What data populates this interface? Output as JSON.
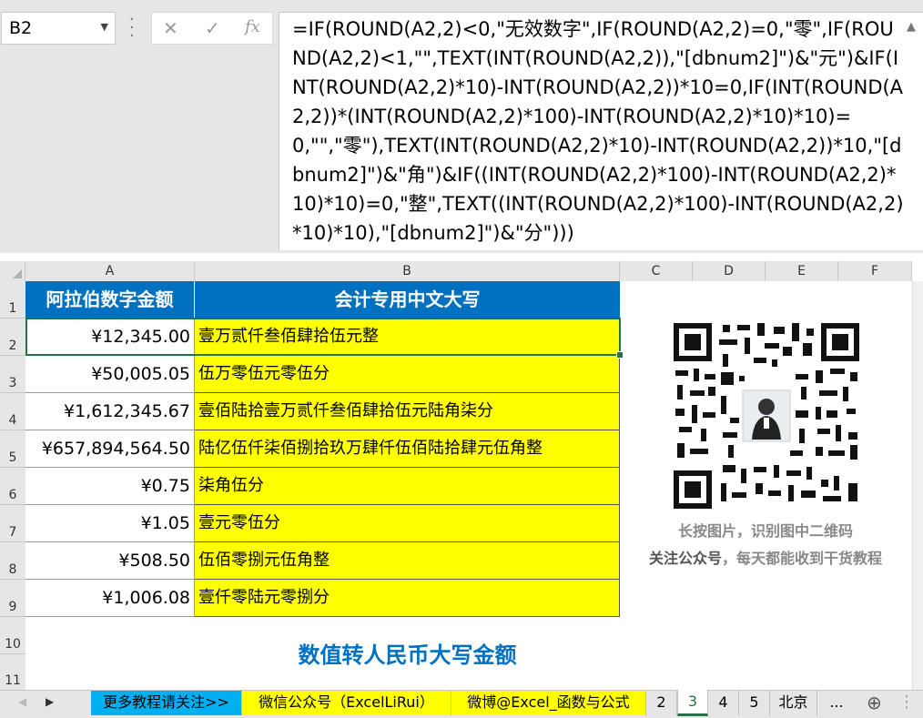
{
  "formula_bar": {
    "name_box": "B2",
    "cancel_glyph": "✕",
    "enter_glyph": "✓",
    "fx_label": "fx",
    "formula": "=IF(ROUND(A2,2)<0,\"无效数字\",IF(ROUND(A2,2)=0,\"零\",IF(ROUND(A2,2)<1,\"\",TEXT(INT(ROUND(A2,2)),\"[dbnum2]\")&\"元\")&IF(INT(ROUND(A2,2)*10)-INT(ROUND(A2,2))*10=0,IF(INT(ROUND(A2,2))*(INT(ROUND(A2,2)*100)-INT(ROUND(A2,2)*10)*10)=0,\"\",\"零\"),TEXT(INT(ROUND(A2,2)*10)-INT(ROUND(A2,2))*10,\"[dbnum2]\")&\"角\")&IF((INT(ROUND(A2,2)*100)-INT(ROUND(A2,2)*10)*10)=0,\"整\",TEXT((INT(ROUND(A2,2)*100)-INT(ROUND(A2,2)*10)*10),\"[dbnum2]\")&\"分\")))"
  },
  "columns": [
    "A",
    "B",
    "C",
    "D",
    "E",
    "F"
  ],
  "rows": [
    "1",
    "2",
    "3",
    "4",
    "5",
    "6",
    "7",
    "8",
    "9",
    "10",
    "11"
  ],
  "table": {
    "header_a": "阿拉伯数字金额",
    "header_b": "会计专用中文大写",
    "data": [
      {
        "amount": "¥12,345.00",
        "chinese": "壹万贰仟叁佰肆拾伍元整"
      },
      {
        "amount": "¥50,005.05",
        "chinese": "伍万零伍元零伍分"
      },
      {
        "amount": "¥1,612,345.67",
        "chinese": "壹佰陆拾壹万贰仟叁佰肆拾伍元陆角柒分"
      },
      {
        "amount": "¥657,894,564.50",
        "chinese": "陆亿伍仟柒佰捌拾玖万肆仟伍佰陆拾肆元伍角整"
      },
      {
        "amount": "¥0.75",
        "chinese": "柒角伍分"
      },
      {
        "amount": "¥1.05",
        "chinese": "壹元零伍分"
      },
      {
        "amount": "¥508.50",
        "chinese": "伍佰零捌元伍角整"
      },
      {
        "amount": "¥1,006.08",
        "chinese": "壹仟零陆元零捌分"
      }
    ]
  },
  "sheet_title": "数值转人民币大写金额",
  "qr": {
    "caption1": "长按图片，识别图中二维码",
    "caption2_bold": "关注公众号",
    "caption2_rest": "，每天都能收到干货教程"
  },
  "tabs": [
    {
      "label": "更多教程请关注>>",
      "color": "#00b0f0"
    },
    {
      "label": "微信公众号（ExcelLiRui）",
      "color": "#ffff00"
    },
    {
      "label": "微博@Excel_函数与公式",
      "color": "#ffff00"
    },
    {
      "label": "2",
      "color": ""
    },
    {
      "label": "3",
      "color": "#ffffff",
      "active": true
    },
    {
      "label": "4",
      "color": ""
    },
    {
      "label": "5",
      "color": ""
    },
    {
      "label": "北京",
      "color": ""
    },
    {
      "label": "...",
      "color": ""
    }
  ],
  "colors": {
    "header_bg": "#0070c0",
    "result_bg": "#ffff00",
    "selection": "#217346"
  }
}
